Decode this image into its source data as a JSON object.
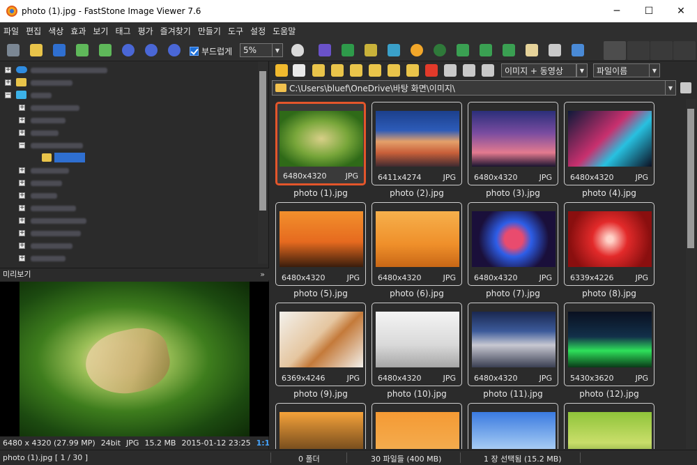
{
  "window": {
    "title": "photo (1).jpg  -  FastStone Image Viewer 7.6",
    "minimize": "─",
    "maximize": "☐",
    "close": "✕"
  },
  "menu": [
    "파일",
    "편집",
    "색상",
    "효과",
    "보기",
    "태그",
    "평가",
    "즐겨찾기",
    "만들기",
    "도구",
    "설정",
    "도움말"
  ],
  "toolbar": {
    "smooth_label": "부드럽게",
    "zoom_value": "5%",
    "view_filter": "이미지 + 동영상",
    "sort_by": "파일이름"
  },
  "path": "C:\\Users\\bluef\\OneDrive\\바탕 화면\\이미지\\",
  "preview": {
    "header": "미리보기",
    "info": {
      "dimensions": "6480 x 4320 (27.99 MP)",
      "bitdepth": "24bit",
      "format": "JPG",
      "size": "15.2 MB",
      "datetime": "2015-01-12 23:25",
      "ratio": "1:1"
    }
  },
  "thumbnails": [
    {
      "name": "photo (1).jpg",
      "dim": "6480x4320",
      "fmt": "JPG",
      "selected": true
    },
    {
      "name": "photo (2).jpg",
      "dim": "6411x4274",
      "fmt": "JPG"
    },
    {
      "name": "photo (3).jpg",
      "dim": "6480x4320",
      "fmt": "JPG"
    },
    {
      "name": "photo (4).jpg",
      "dim": "6480x4320",
      "fmt": "JPG"
    },
    {
      "name": "photo (5).jpg",
      "dim": "6480x4320",
      "fmt": "JPG"
    },
    {
      "name": "photo (6).jpg",
      "dim": "6480x4320",
      "fmt": "JPG"
    },
    {
      "name": "photo (7).jpg",
      "dim": "6480x4320",
      "fmt": "JPG"
    },
    {
      "name": "photo (8).jpg",
      "dim": "6339x4226",
      "fmt": "JPG"
    },
    {
      "name": "photo (9).jpg",
      "dim": "6369x4246",
      "fmt": "JPG"
    },
    {
      "name": "photo (10).jpg",
      "dim": "6480x4320",
      "fmt": "JPG"
    },
    {
      "name": "photo (11).jpg",
      "dim": "6480x4320",
      "fmt": "JPG"
    },
    {
      "name": "photo (12).jpg",
      "dim": "5430x3620",
      "fmt": "JPG"
    }
  ],
  "status": {
    "current": "photo (1).jpg [ 1 / 30 ]",
    "folders": "0 폴더",
    "files": "30 파일들 (400 MB)",
    "selected": "1 장 선택됨 (15.2 MB)"
  }
}
